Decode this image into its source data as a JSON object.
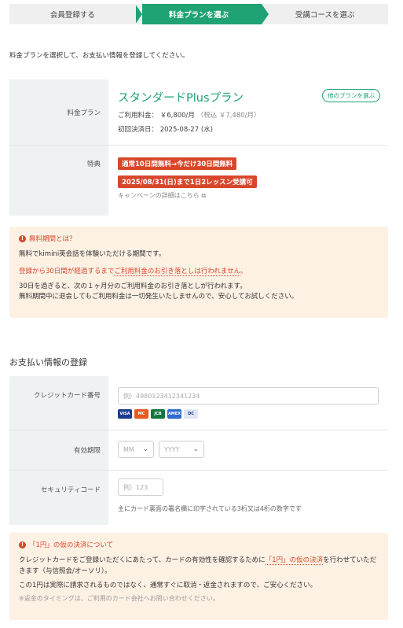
{
  "steps": [
    "会員登録する",
    "料金プランを選ぶ",
    "受講コースを選ぶ"
  ],
  "intro": "料金プランを選択して、お支払い情報を登録してください。",
  "plan": {
    "label": "料金プラン",
    "name": "スタンダードPlusプラン",
    "other_button": "他のプランを選ぶ",
    "fee_label": "ご利用料金：",
    "fee_value": "￥6,800/月",
    "fee_tax": "（税込 ￥7,480/月）",
    "first_date_label": "初回決済日：",
    "first_date_value": "2025-08-27 (水)"
  },
  "benefit": {
    "label": "特典",
    "badge1": "通常10日間無料→今だけ30日間無料",
    "badge2": "2025/08/31(日)まで1日2レッスン受講可",
    "detail_link": "キャンペーンの詳細はこちら"
  },
  "free_notice": {
    "title": "無料期間とは？",
    "p1": "無料でkimini英会話を体験いただける期間です。",
    "p2_prefix": "登録から30日間が経過するまで",
    "p2_emph": "ご利用料金のお引き落としは行われません",
    "p2_suffix": "。",
    "p3a": "30日を過ぎると、次の１ヶ月分のご利用料金のお引き落としが行われます。",
    "p3b": "無料期間中に退会してもご利用料金は一切発生いたしませんので、安心してお試しください。"
  },
  "payment": {
    "title": "お支払い情報の登録",
    "card_label": "クレジットカード番号",
    "card_placeholder": "例）4980123412341234",
    "card_brands": [
      "VISA",
      "MC",
      "JCB",
      "AMEX",
      "DC"
    ],
    "expiry_label": "有効期限",
    "month_placeholder": "MM",
    "year_placeholder": "YYYY",
    "cvc_label": "セキュリティコード",
    "cvc_placeholder": "例）123",
    "cvc_help": "主にカード裏面の署名欄に印字されている3桁又は4桁の数字です"
  },
  "auth_notice": {
    "title": "「1円」の仮の決済について",
    "p1_prefix": "クレジットカードをご登録いただくにあたって、カードの有効性を確認するために",
    "p1_emph": "「1円」の仮の決済",
    "p1_suffix": "を行わせていただきます（与信照会/オーソリ）。",
    "p2": "この1円は実際に請求されるものではなく、通常すぐに取消・返金されますので、ご安心ください。",
    "p3": "※返金のタイミングは、ご利用のカード会社へお問い合わせください。"
  },
  "colors": {
    "accent": "#1fa274",
    "alert": "#d9472b",
    "notice_bg": "#fdf1e4",
    "label_bg": "#eef2f2"
  }
}
